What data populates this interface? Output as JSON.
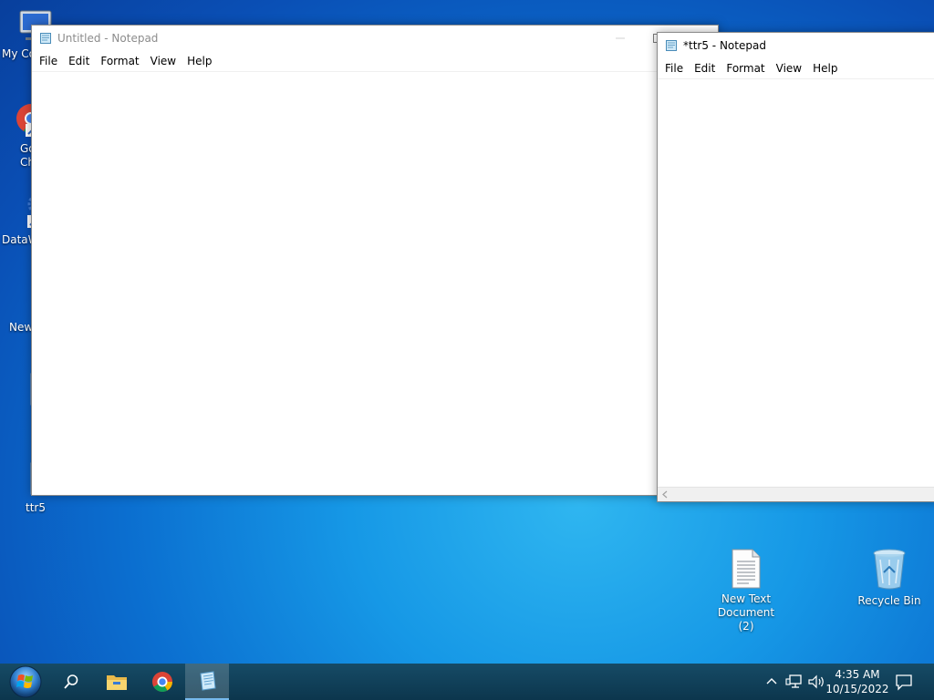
{
  "desktop": {
    "icons_left": [
      {
        "label": "My Co",
        "icon": "computer-icon"
      },
      {
        "label": "Go\nCh",
        "icon": "chrome-shortcut-icon"
      },
      {
        "label": "DataW",
        "icon": "datawin-shortcut-icon"
      },
      {
        "label": "New",
        "icon": "folder-icon"
      },
      {
        "label": "",
        "icon": "image-file-icon"
      },
      {
        "label": "ttr5",
        "icon": "image-file-icon"
      }
    ],
    "icons_right": [
      {
        "label": "New Text Document (2)",
        "icon": "text-document-icon"
      },
      {
        "label": "Recycle Bin",
        "icon": "recycle-bin-icon"
      }
    ]
  },
  "window_untitled": {
    "title": "Untitled - Notepad",
    "menu": [
      "File",
      "Edit",
      "Format",
      "View",
      "Help"
    ],
    "content": ""
  },
  "window_ttr5": {
    "title": "*ttr5 - Notepad",
    "menu": [
      "File",
      "Edit",
      "Format",
      "View",
      "Help"
    ],
    "content": ""
  },
  "taskbar": {
    "buttons": [
      "start-button",
      "search-icon",
      "file-explorer-icon",
      "chrome-icon",
      "notepad-icon"
    ],
    "clock_time": "4:35 AM",
    "clock_date": "10/15/2022"
  },
  "colors": {
    "taskbar": "#0f3e57",
    "accent": "#76b9ed"
  }
}
